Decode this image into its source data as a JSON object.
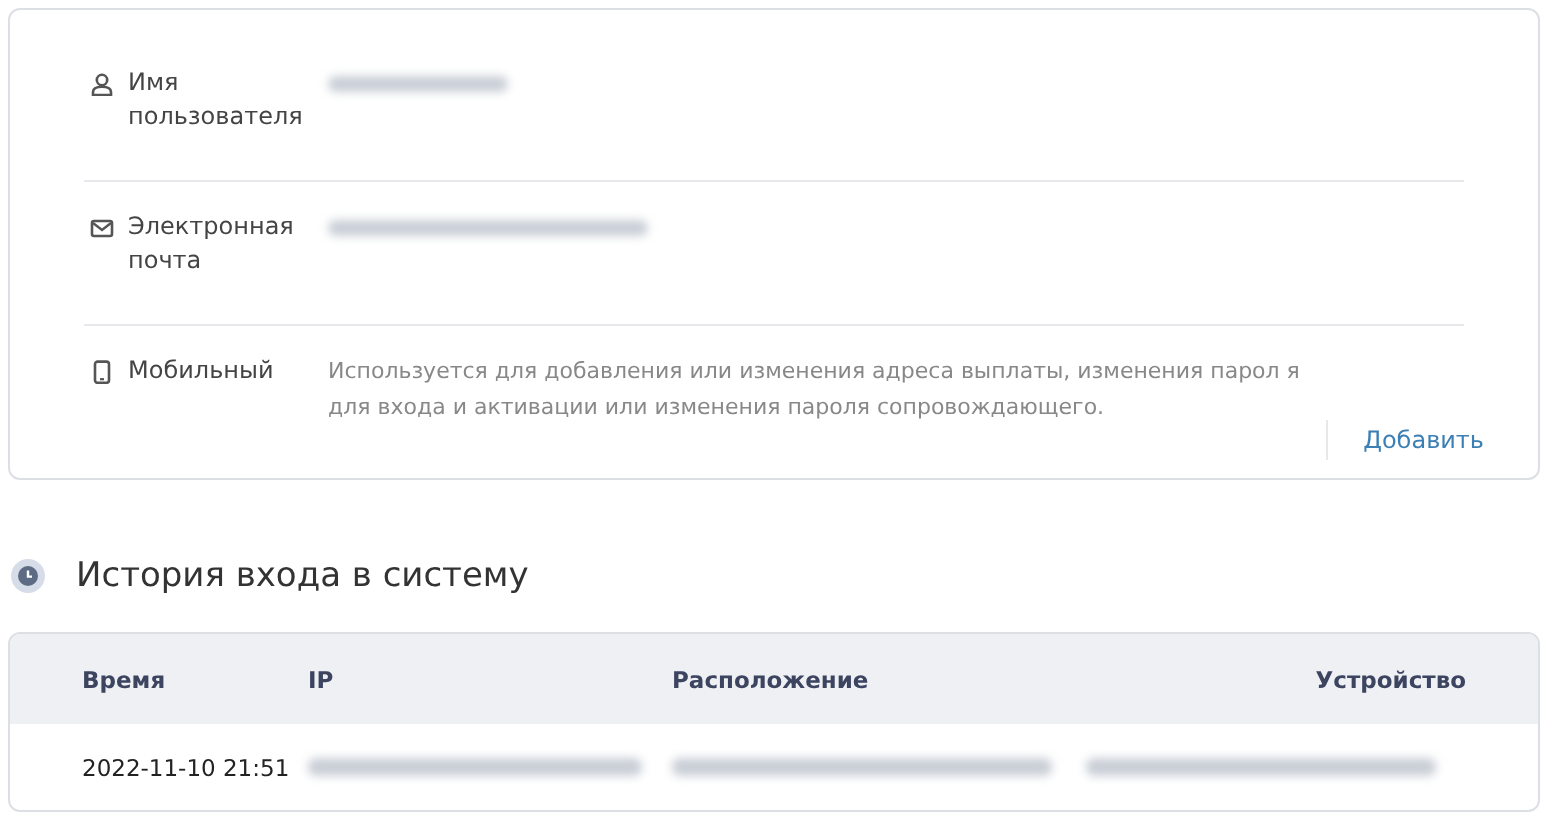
{
  "profile": {
    "rows": [
      {
        "kind": "user",
        "label": "Имя пользователя",
        "blurred": true
      },
      {
        "kind": "mail",
        "label": "Электронная почта",
        "blurred": true
      },
      {
        "kind": "phone",
        "label": "Мобильный",
        "description": "Используется для добавления или изменения адреса выплаты, изменения парол я для входа и активации или изменения пароля сопровождающего.",
        "action": "Добавить"
      }
    ]
  },
  "login_history": {
    "title": "История входа в систему",
    "table": {
      "columns": [
        "Время",
        "IP",
        "Расположение",
        "Устройство"
      ],
      "rows": [
        {
          "cells": [
            {
              "text": "2022-11-10 21:51"
            },
            {
              "blurred": true
            },
            {
              "blurred": true
            },
            {
              "blurred": true
            }
          ]
        }
      ]
    }
  }
}
